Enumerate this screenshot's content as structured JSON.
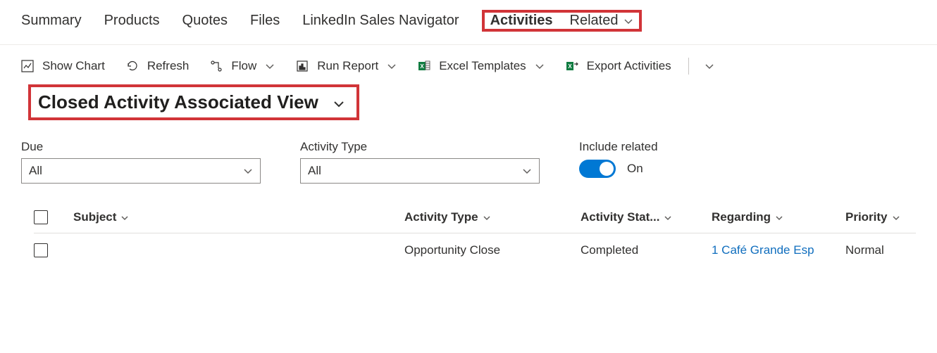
{
  "tabs": {
    "summary": "Summary",
    "products": "Products",
    "quotes": "Quotes",
    "files": "Files",
    "linkedin": "LinkedIn Sales Navigator",
    "activities": "Activities",
    "related": "Related"
  },
  "toolbar": {
    "show_chart": "Show Chart",
    "refresh": "Refresh",
    "flow": "Flow",
    "run_report": "Run Report",
    "excel_templates": "Excel Templates",
    "export_activities": "Export Activities"
  },
  "view": {
    "name": "Closed Activity Associated View"
  },
  "filters": {
    "due_label": "Due",
    "due_value": "All",
    "activity_type_label": "Activity Type",
    "activity_type_value": "All",
    "include_related_label": "Include related",
    "toggle_text": "On"
  },
  "table": {
    "headers": {
      "subject": "Subject",
      "activity_type": "Activity Type",
      "activity_status": "Activity Stat...",
      "regarding": "Regarding",
      "priority": "Priority"
    },
    "rows": [
      {
        "subject": "",
        "activity_type": "Opportunity Close",
        "activity_status": "Completed",
        "regarding": "1 Café Grande Esp",
        "priority": "Normal"
      }
    ]
  }
}
